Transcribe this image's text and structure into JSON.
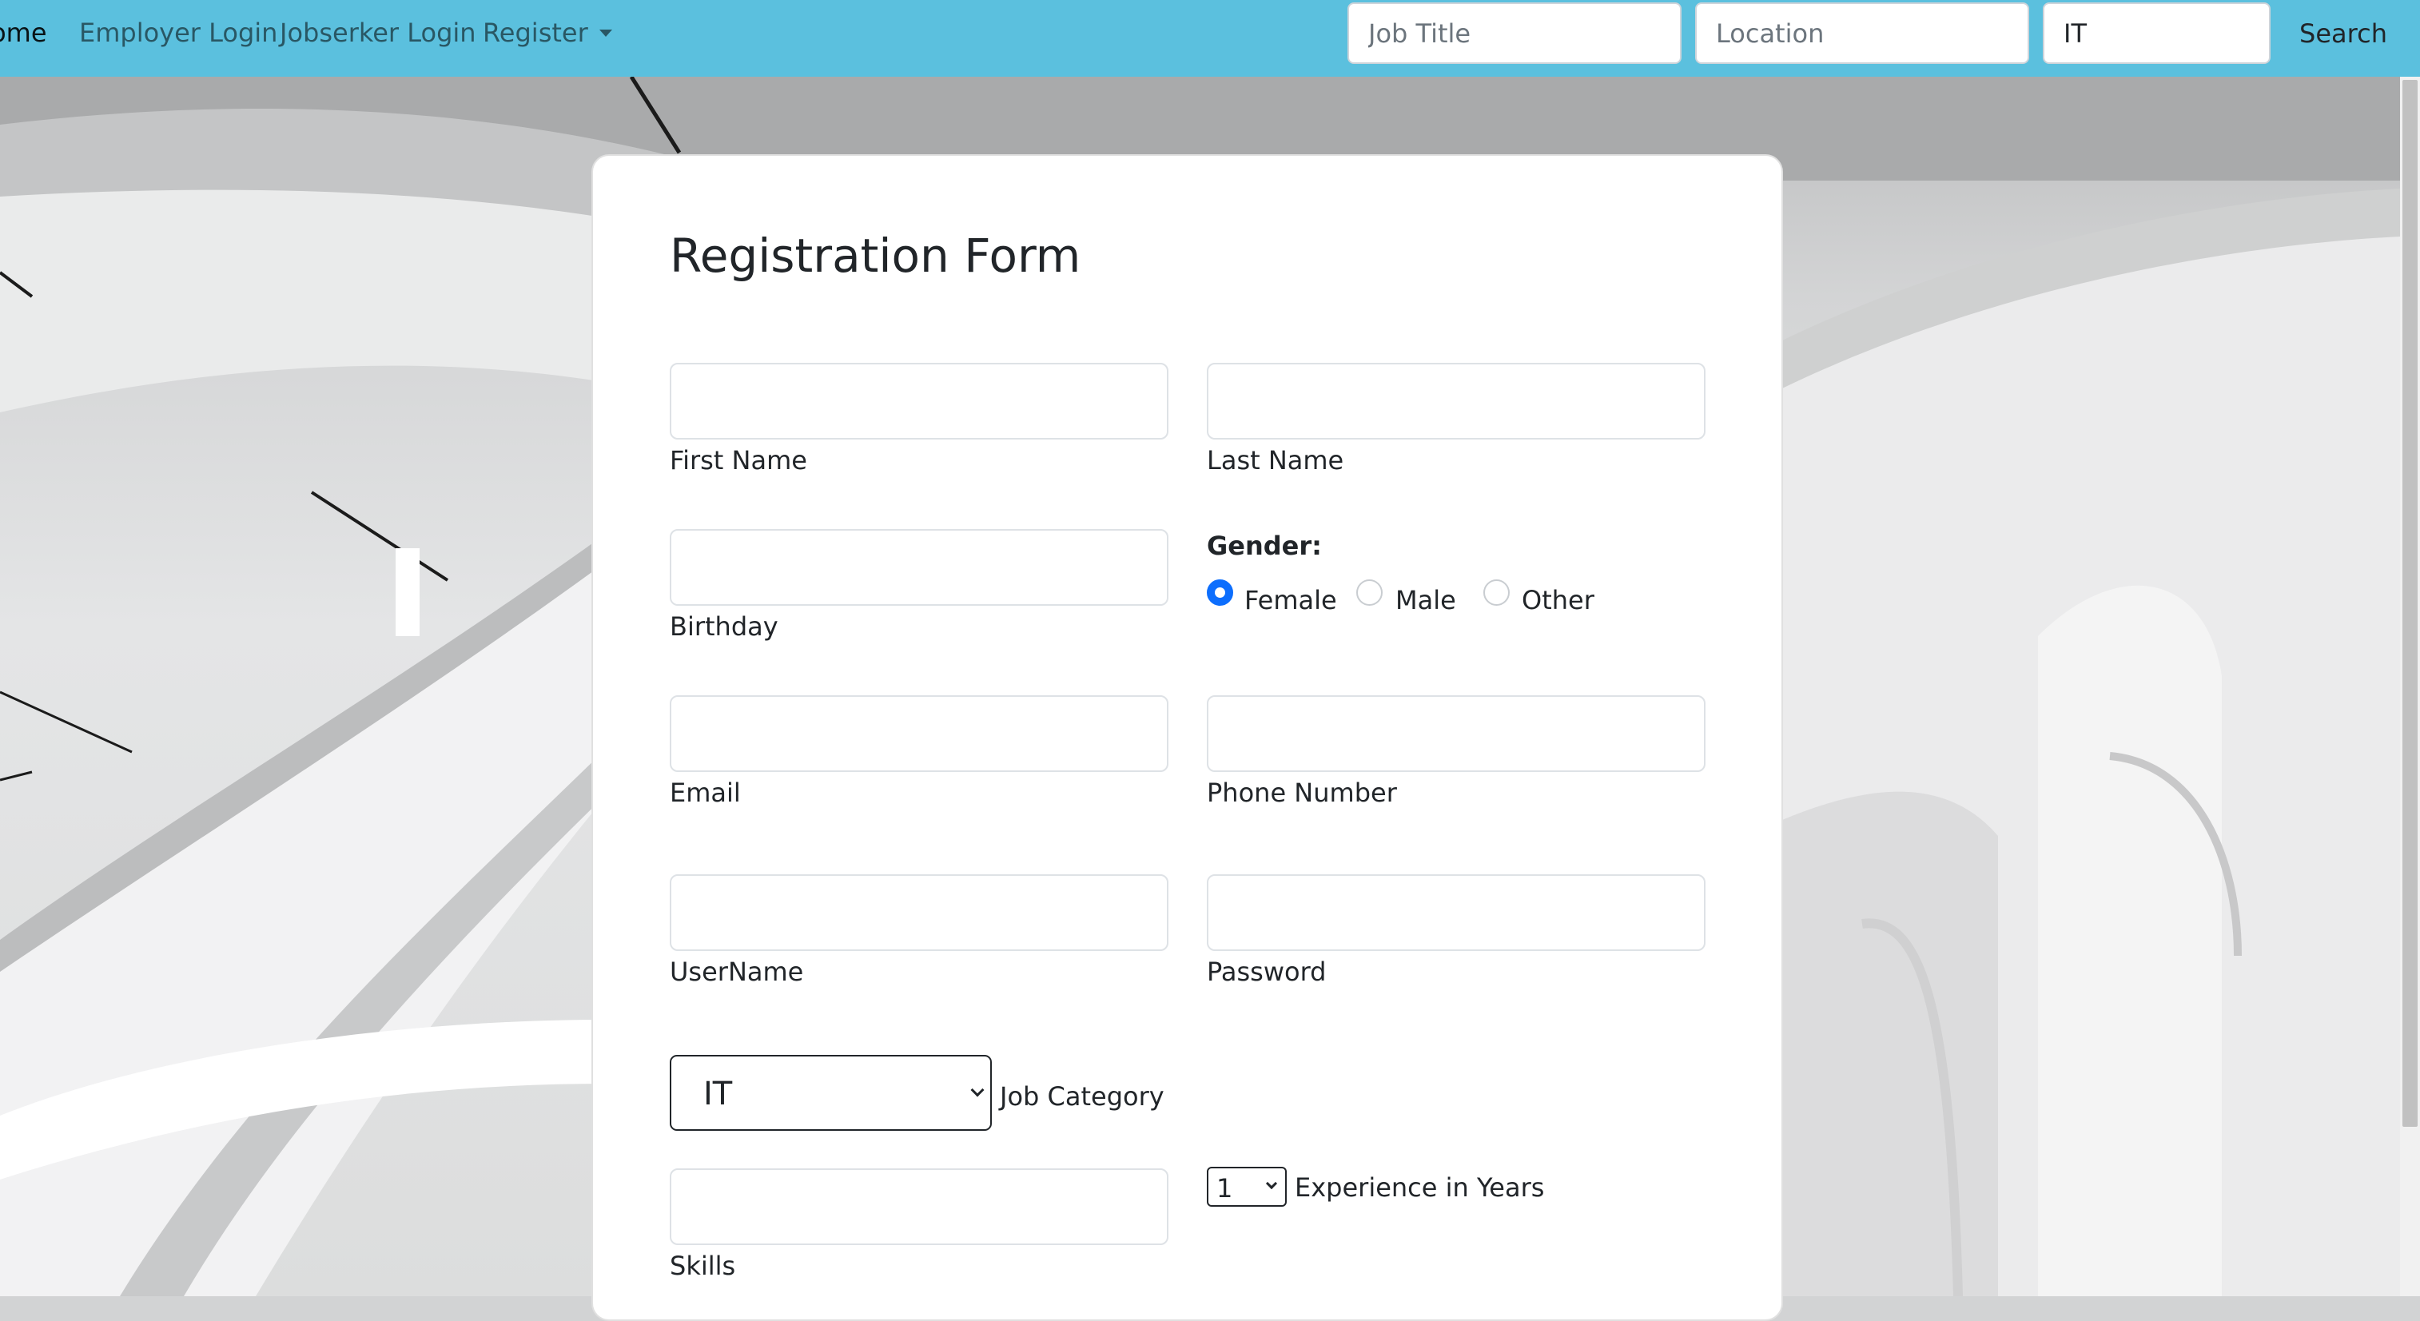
{
  "navbar": {
    "links": {
      "home": "Home",
      "employer_login": "Employer Login",
      "jobseeker_login": "Jobserker Login",
      "register": "Register"
    },
    "search": {
      "job_title_placeholder": "Job Title",
      "location_placeholder": "Location",
      "category_value": "IT",
      "button_label": "Search"
    },
    "accent_color": "#5bc0de"
  },
  "form": {
    "title": "Registration Form",
    "fields": {
      "first_name_label": "First Name",
      "last_name_label": "Last Name",
      "birthday_label": "Birthday",
      "email_label": "Email",
      "phone_label": "Phone Number",
      "username_label": "UserName",
      "password_label": "Password",
      "skills_label": "Skills"
    },
    "gender": {
      "label": "Gender:",
      "options": [
        "Female",
        "Male",
        "Other"
      ],
      "selected": "Female"
    },
    "job_category": {
      "value": "IT",
      "label": "Job Category"
    },
    "experience": {
      "value": "1",
      "label": "Experience in Years"
    },
    "radio_color": "#0d6efd"
  }
}
